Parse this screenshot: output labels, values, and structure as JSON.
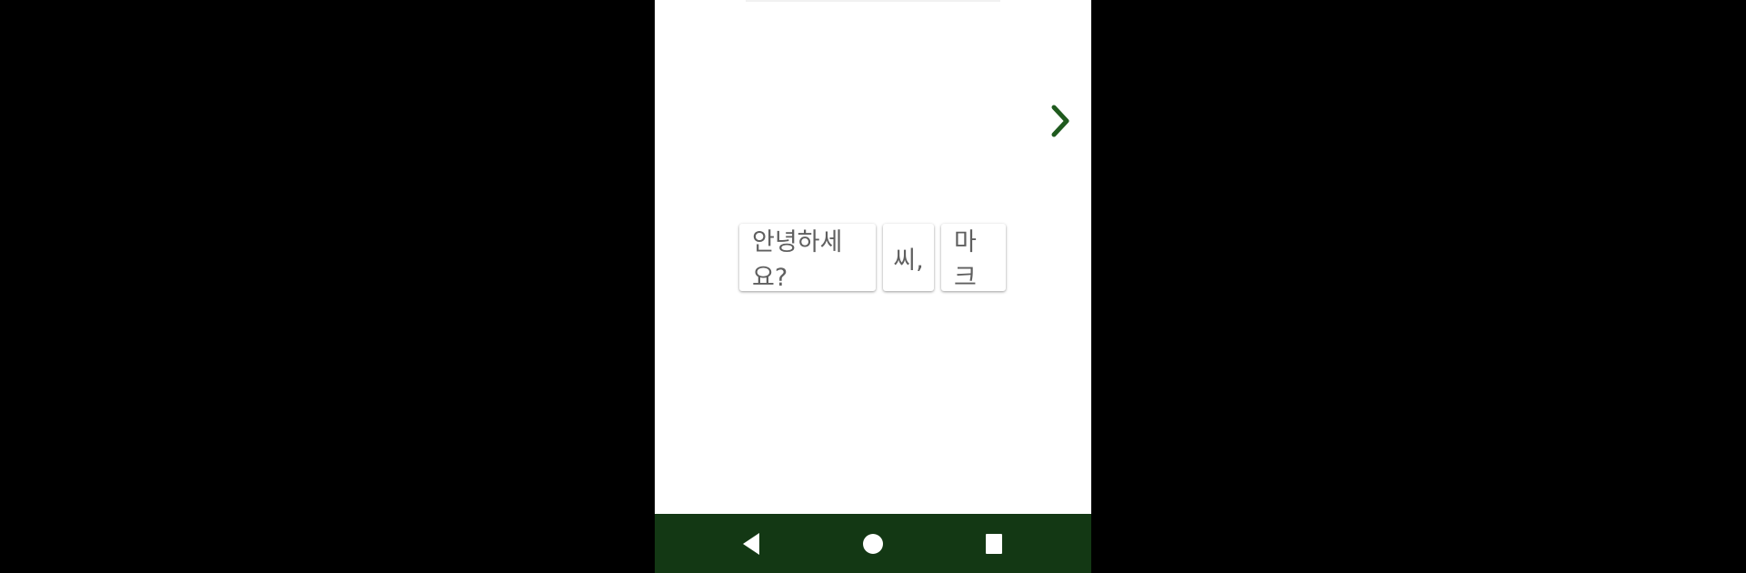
{
  "colors": {
    "accent": "#1f5a1e",
    "navbar": "#133814",
    "chip_text": "#5f5f5f",
    "page_bg": "#ffffff",
    "letterbox": "#000000"
  },
  "pager": {
    "next_icon": "chevron-right-icon"
  },
  "sentence": {
    "chips": [
      {
        "text": "안녕하세요?"
      },
      {
        "text": "씨,"
      },
      {
        "text": "마크"
      }
    ]
  },
  "navbar": {
    "back_icon": "triangle-back-icon",
    "home_icon": "circle-home-icon",
    "recent_icon": "square-recent-apps-icon"
  }
}
